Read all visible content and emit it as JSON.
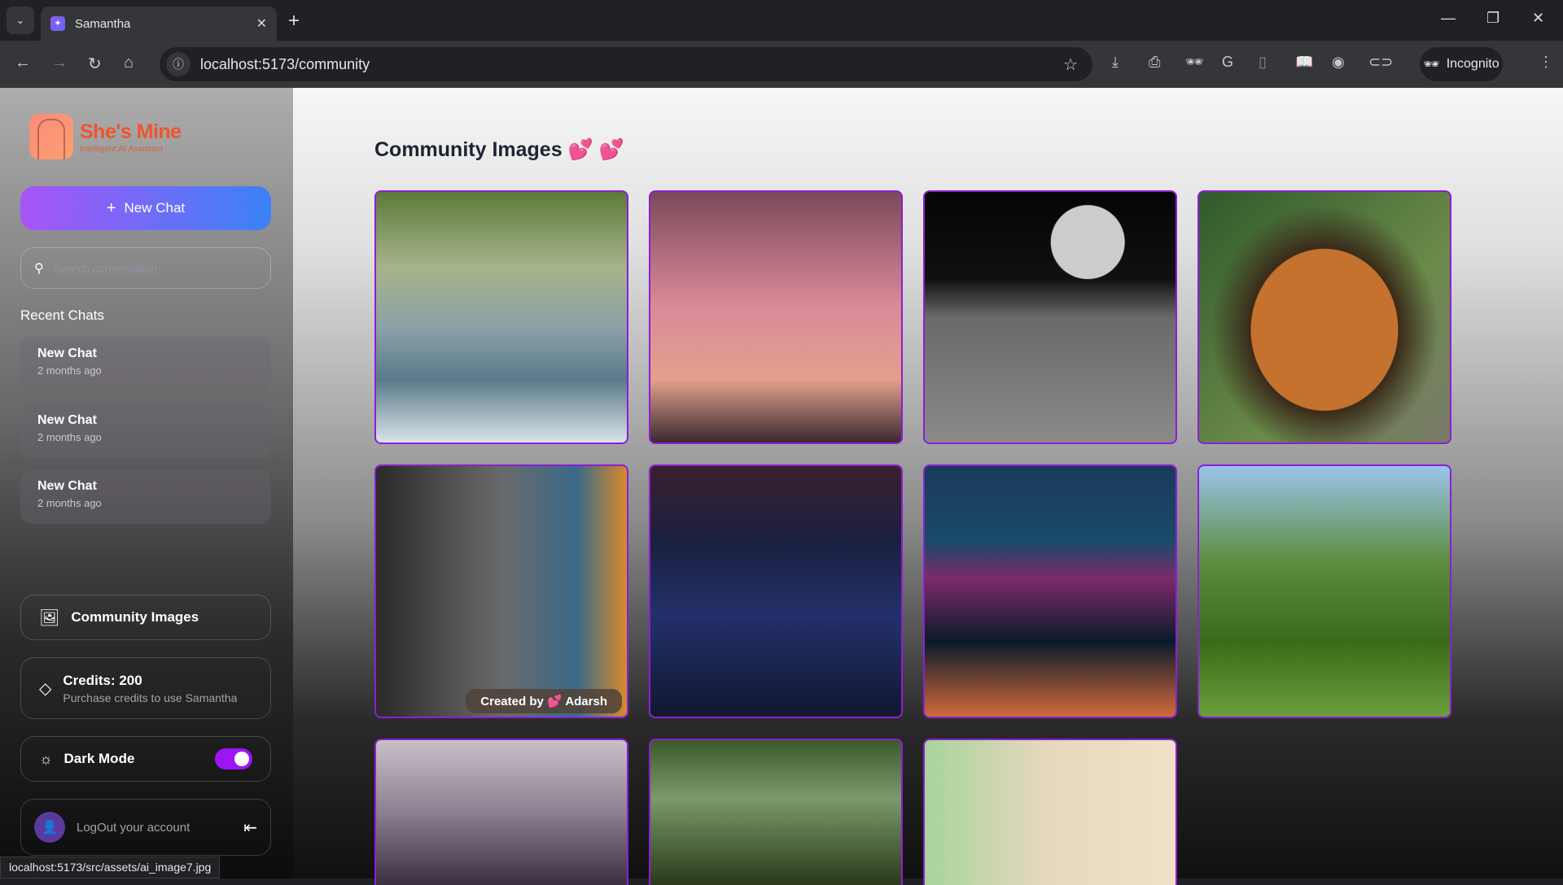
{
  "browser": {
    "tab_title": "Samantha",
    "url": "localhost:5173/community",
    "incognito_label": "Incognito",
    "status_url": "localhost:5173/src/assets/ai_image7.jpg"
  },
  "sidebar": {
    "logo_title": "She's Mine",
    "logo_subtitle": "Intelligent AI Assistant",
    "new_chat_label": "New Chat",
    "search_placeholder": "Search conversation",
    "recent_label": "Recent Chats",
    "chats": [
      {
        "name": "New Chat",
        "time": "2 months ago"
      },
      {
        "name": "New Chat",
        "time": "2 months ago"
      },
      {
        "name": "New Chat",
        "time": "2 months ago"
      }
    ],
    "community_label": "Community Images",
    "credits_label": "Credits: 200",
    "credits_sub": "Purchase credits to use Samantha",
    "dark_mode_label": "Dark Mode",
    "dark_mode_on": true,
    "logout_label": "LogOut your account"
  },
  "main": {
    "title": "Community Images",
    "title_emoji": "💕 💕",
    "caption_prefix": "Created by",
    "caption_emoji": "💕",
    "caption_author": "Adarsh"
  },
  "colors": {
    "accent": "#9b16f5",
    "image_border": "#8b1fd6"
  }
}
